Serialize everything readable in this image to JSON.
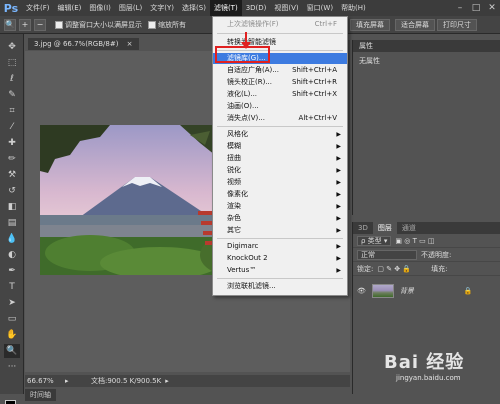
{
  "app": {
    "logo": "Ps"
  },
  "menubar": {
    "items": [
      "文件(F)",
      "编辑(E)",
      "图像(I)",
      "图层(L)",
      "文字(Y)",
      "选择(S)",
      "滤镜(T)",
      "3D(D)",
      "视图(V)",
      "窗口(W)",
      "帮助(H)"
    ],
    "active_index": 6,
    "win_controls": [
      "–",
      "□",
      "✕"
    ]
  },
  "options_bar": {
    "resize_windows_label": "调整窗口大小以满屏显示",
    "zoom_all_label": "缩放所有",
    "fill_screen_btn": "填充屏幕",
    "fit_screen_btn": "适合屏幕",
    "print_size_btn": "打印尺寸"
  },
  "document": {
    "tab_title": "3.jpg @ 66.7%(RGB/8#)",
    "close_icon": "×",
    "zoom": "66.67%",
    "doc_info": "文档:900.5 K/900.5K",
    "bottom_tab": "时间轴"
  },
  "filter_menu": {
    "items": [
      {
        "label": "上次滤镜操作(F)",
        "shortcut": "Ctrl+F",
        "disabled": true
      },
      {
        "label": "转换为智能滤镜",
        "shortcut": ""
      },
      {
        "label": "滤镜库(G)...",
        "shortcut": "",
        "highlight": true
      },
      {
        "label": "自适应广角(A)...",
        "shortcut": "Shift+Ctrl+A"
      },
      {
        "label": "镜头校正(R)...",
        "shortcut": "Shift+Ctrl+R"
      },
      {
        "label": "液化(L)...",
        "shortcut": "Shift+Ctrl+X"
      },
      {
        "label": "油画(O)...",
        "shortcut": ""
      },
      {
        "label": "消失点(V)...",
        "shortcut": "Alt+Ctrl+V"
      },
      {
        "label": "风格化",
        "submenu": true
      },
      {
        "label": "模糊",
        "submenu": true
      },
      {
        "label": "扭曲",
        "submenu": true
      },
      {
        "label": "锐化",
        "submenu": true
      },
      {
        "label": "视频",
        "submenu": true
      },
      {
        "label": "像素化",
        "submenu": true
      },
      {
        "label": "渲染",
        "submenu": true
      },
      {
        "label": "杂色",
        "submenu": true
      },
      {
        "label": "其它",
        "submenu": true
      },
      {
        "label": "Digimarc",
        "submenu": true
      },
      {
        "label": "KnockOut 2",
        "submenu": true
      },
      {
        "label": "Vertus™",
        "submenu": true
      },
      {
        "label": "浏览联机滤镜...",
        "shortcut": ""
      }
    ]
  },
  "properties_panel": {
    "title": "属性",
    "value": "无属性"
  },
  "layers_panel": {
    "tabs": [
      "3D",
      "图层",
      "通道"
    ],
    "active_tab": 1,
    "filter_kind": "类型",
    "blend_mode": "正常",
    "opacity_label": "不透明度:",
    "lock_label": "锁定:",
    "fill_label": "填充:",
    "layer_name": "背景"
  },
  "watermark": {
    "brand": "Bai 经验",
    "url": "jingyan.baidu.com"
  }
}
